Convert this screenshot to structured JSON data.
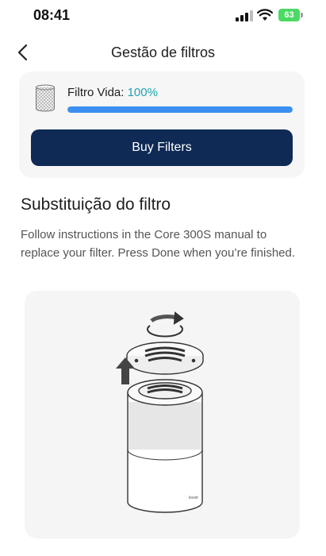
{
  "status_bar": {
    "time": "08:41",
    "battery": "63"
  },
  "header": {
    "title": "Gestão de filtros"
  },
  "filter": {
    "life_label": "Filtro Vida:",
    "life_value": "100%",
    "life_fraction": 1.0,
    "buy_label": "Buy Filters"
  },
  "section": {
    "title": "Substituição do filtro",
    "instructions": "Follow instructions in the Core 300S manual to replace your filter. Press Done when you’re finished."
  },
  "illustration": {
    "brand_text": "levoit"
  },
  "colors": {
    "accent": "#3b8ff0",
    "primary_button": "#0e2a55",
    "life_value": "#1fa3b0",
    "battery": "#4cd964"
  }
}
